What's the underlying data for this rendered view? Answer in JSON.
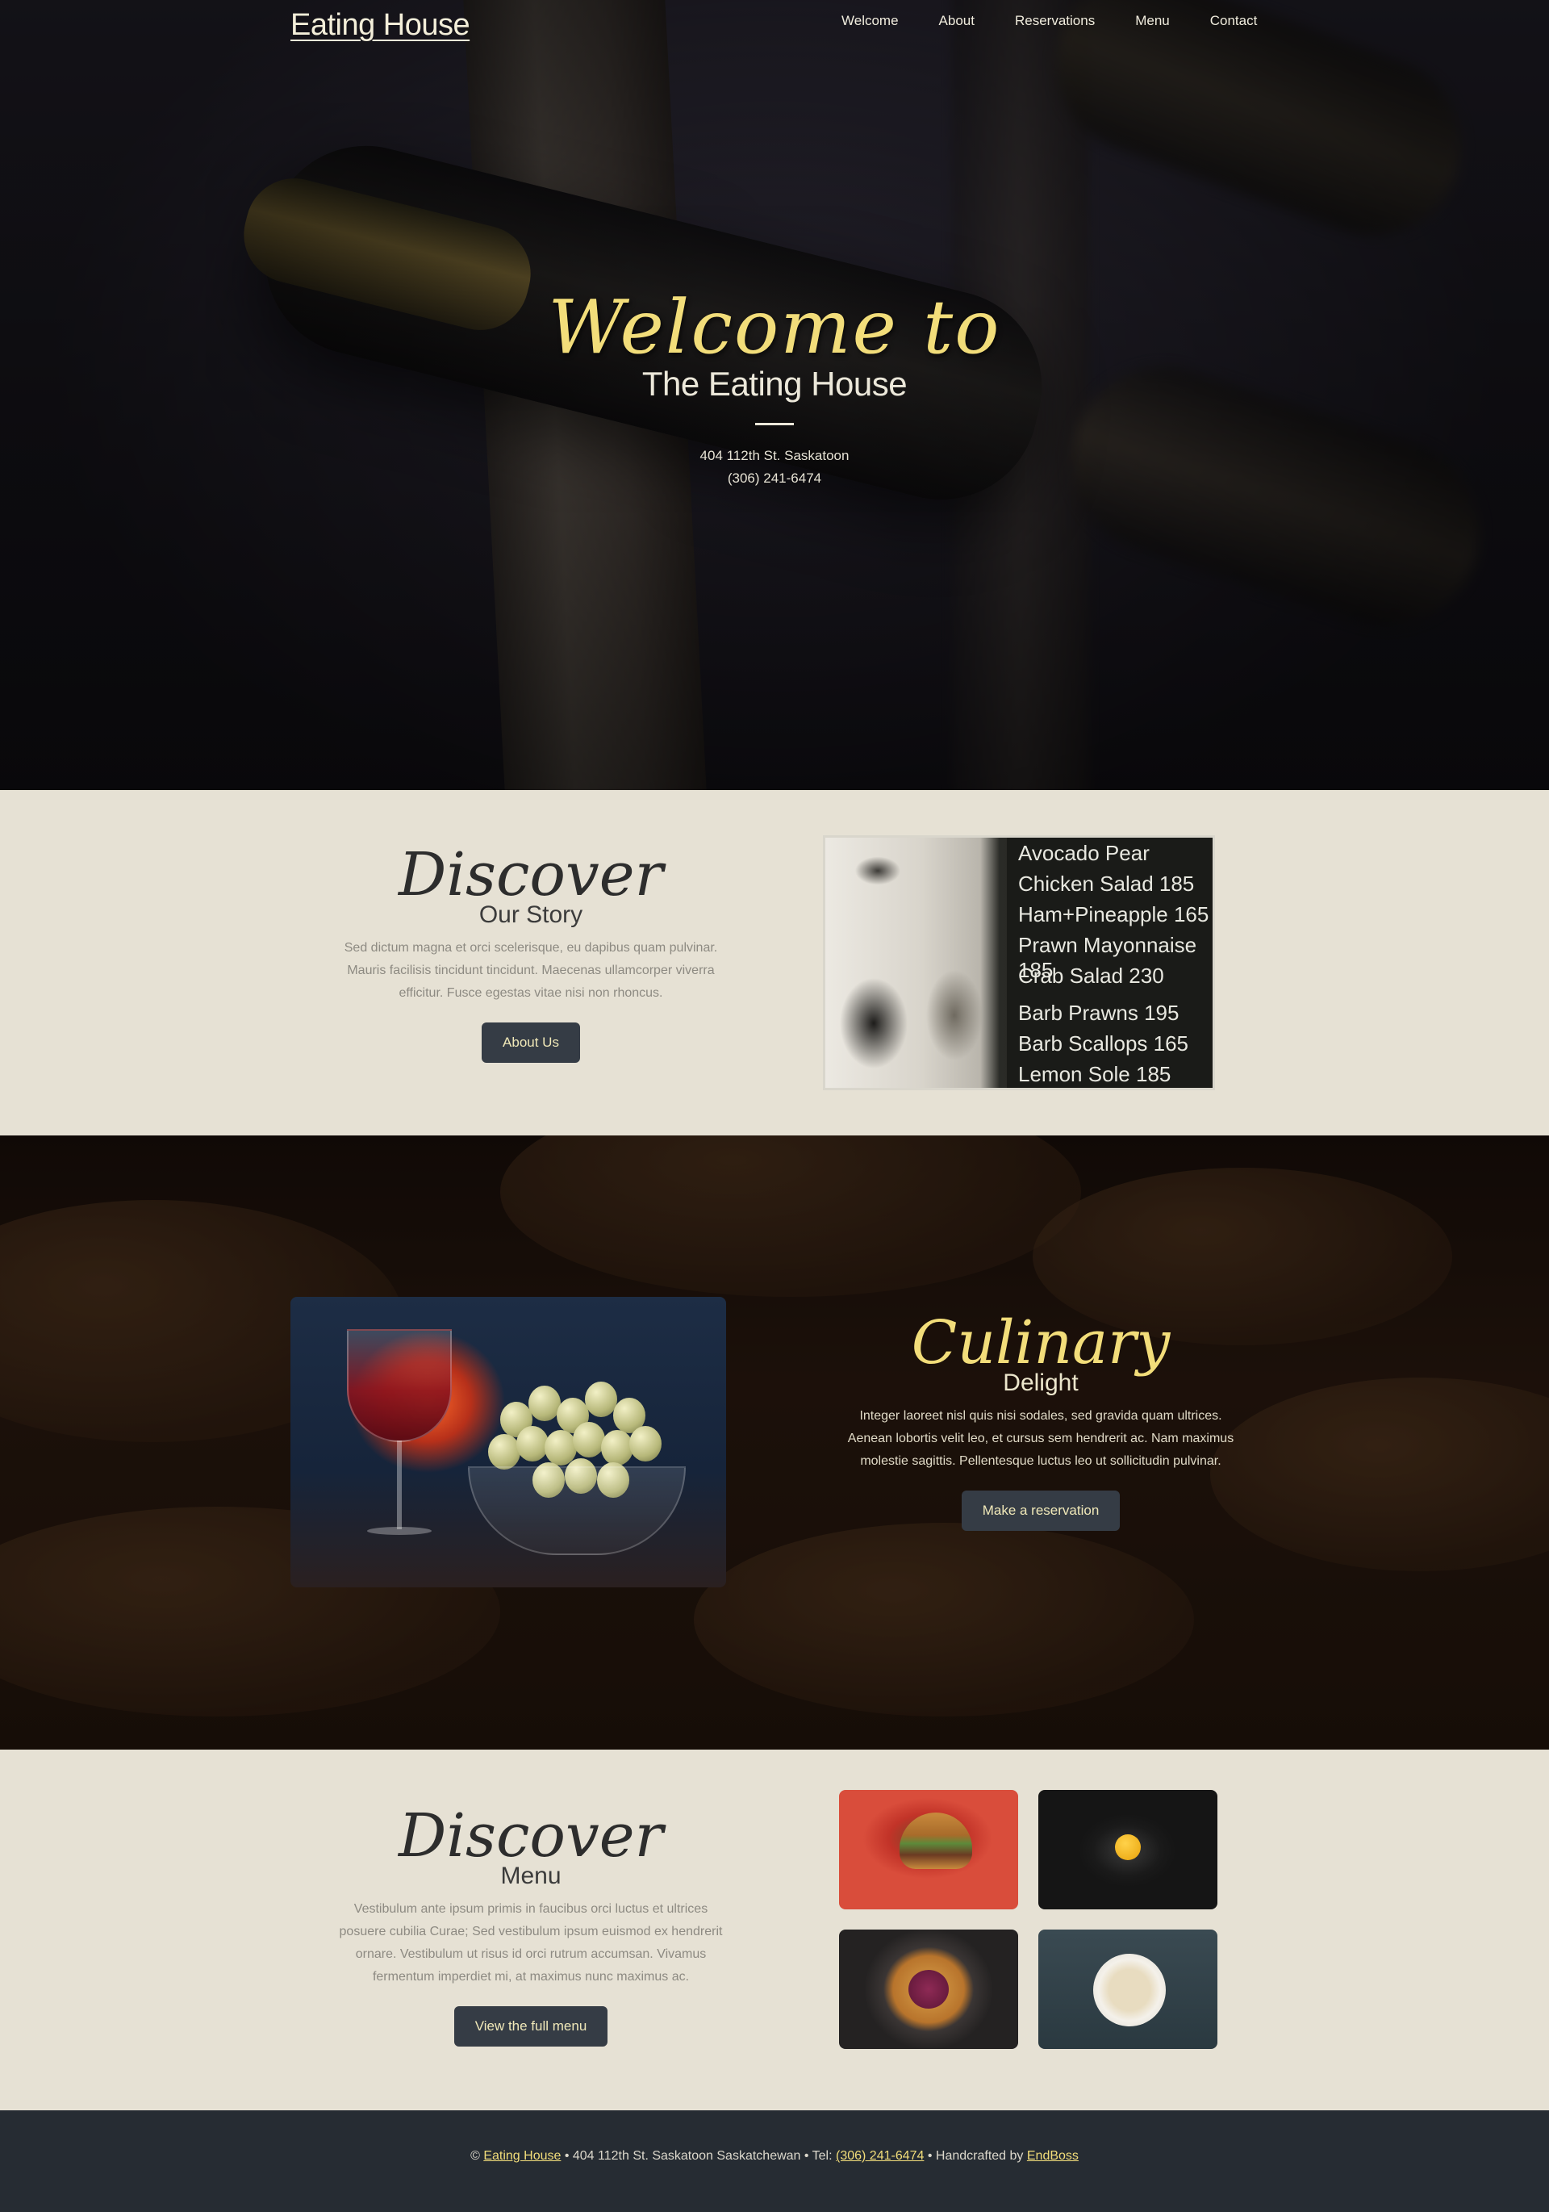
{
  "nav": {
    "brand": "Eating House",
    "links": [
      "Welcome",
      "About",
      "Reservations",
      "Menu",
      "Contact"
    ]
  },
  "hero": {
    "script_title": "Welcome to",
    "subtitle": "The Eating House",
    "address": "404 112th St. Saskatoon",
    "phone": "(306) 241-6474"
  },
  "story": {
    "script_title": "Discover",
    "subtitle": "Our Story",
    "paragraph": "Sed dictum magna et orci scelerisque, eu dapibus quam pulvinar. Mauris facilisis tincidunt tincidunt. Maecenas ullamcorper viverra efficitur. Fusce egestas vitae nisi non rhoncus.",
    "button": "About Us",
    "board_items": [
      "Avocado Pear",
      "Chicken Salad 185",
      "Ham+Pineapple 165",
      "Prawn Mayonnaise 185",
      "Crab Salad 230",
      "Barb Prawns 195",
      "Barb Scallops 165",
      "Lemon Sole 185"
    ]
  },
  "culinary": {
    "script_title": "Culinary",
    "subtitle": "Delight",
    "paragraph": "Integer laoreet nisl quis nisi sodales, sed gravida quam ultrices. Aenean lobortis velit leo, et cursus sem hendrerit ac. Nam maximus molestie sagittis. Pellentesque luctus leo ut sollicitudin pulvinar.",
    "button": "Make a reservation"
  },
  "menu": {
    "script_title": "Discover",
    "subtitle": "Menu",
    "paragraph": "Vestibulum ante ipsum primis in faucibus orci luctus et ultrices posuere cubilia Curae; Sed vestibulum ipsum euismod ex hendrerit ornare. Vestibulum ut risus id orci rutrum accumsan. Vivamus fermentum imperdiet mi, at maximus nunc maximus ac.",
    "button": "View the full menu"
  },
  "footer": {
    "copyright_symbol": "©",
    "brand_link": "Eating House",
    "address_text": " • 404 112th St. Saskatoon Saskatchewan • Tel: ",
    "phone_link": "(306) 241-6474",
    "credit_text": " • Handcrafted by ",
    "credit_link": "EndBoss"
  },
  "colors": {
    "accent_gold": "#f2dd7a",
    "cream_bg": "#e6e1d4",
    "button_bg": "#353c45",
    "footer_bg": "#262c33"
  }
}
